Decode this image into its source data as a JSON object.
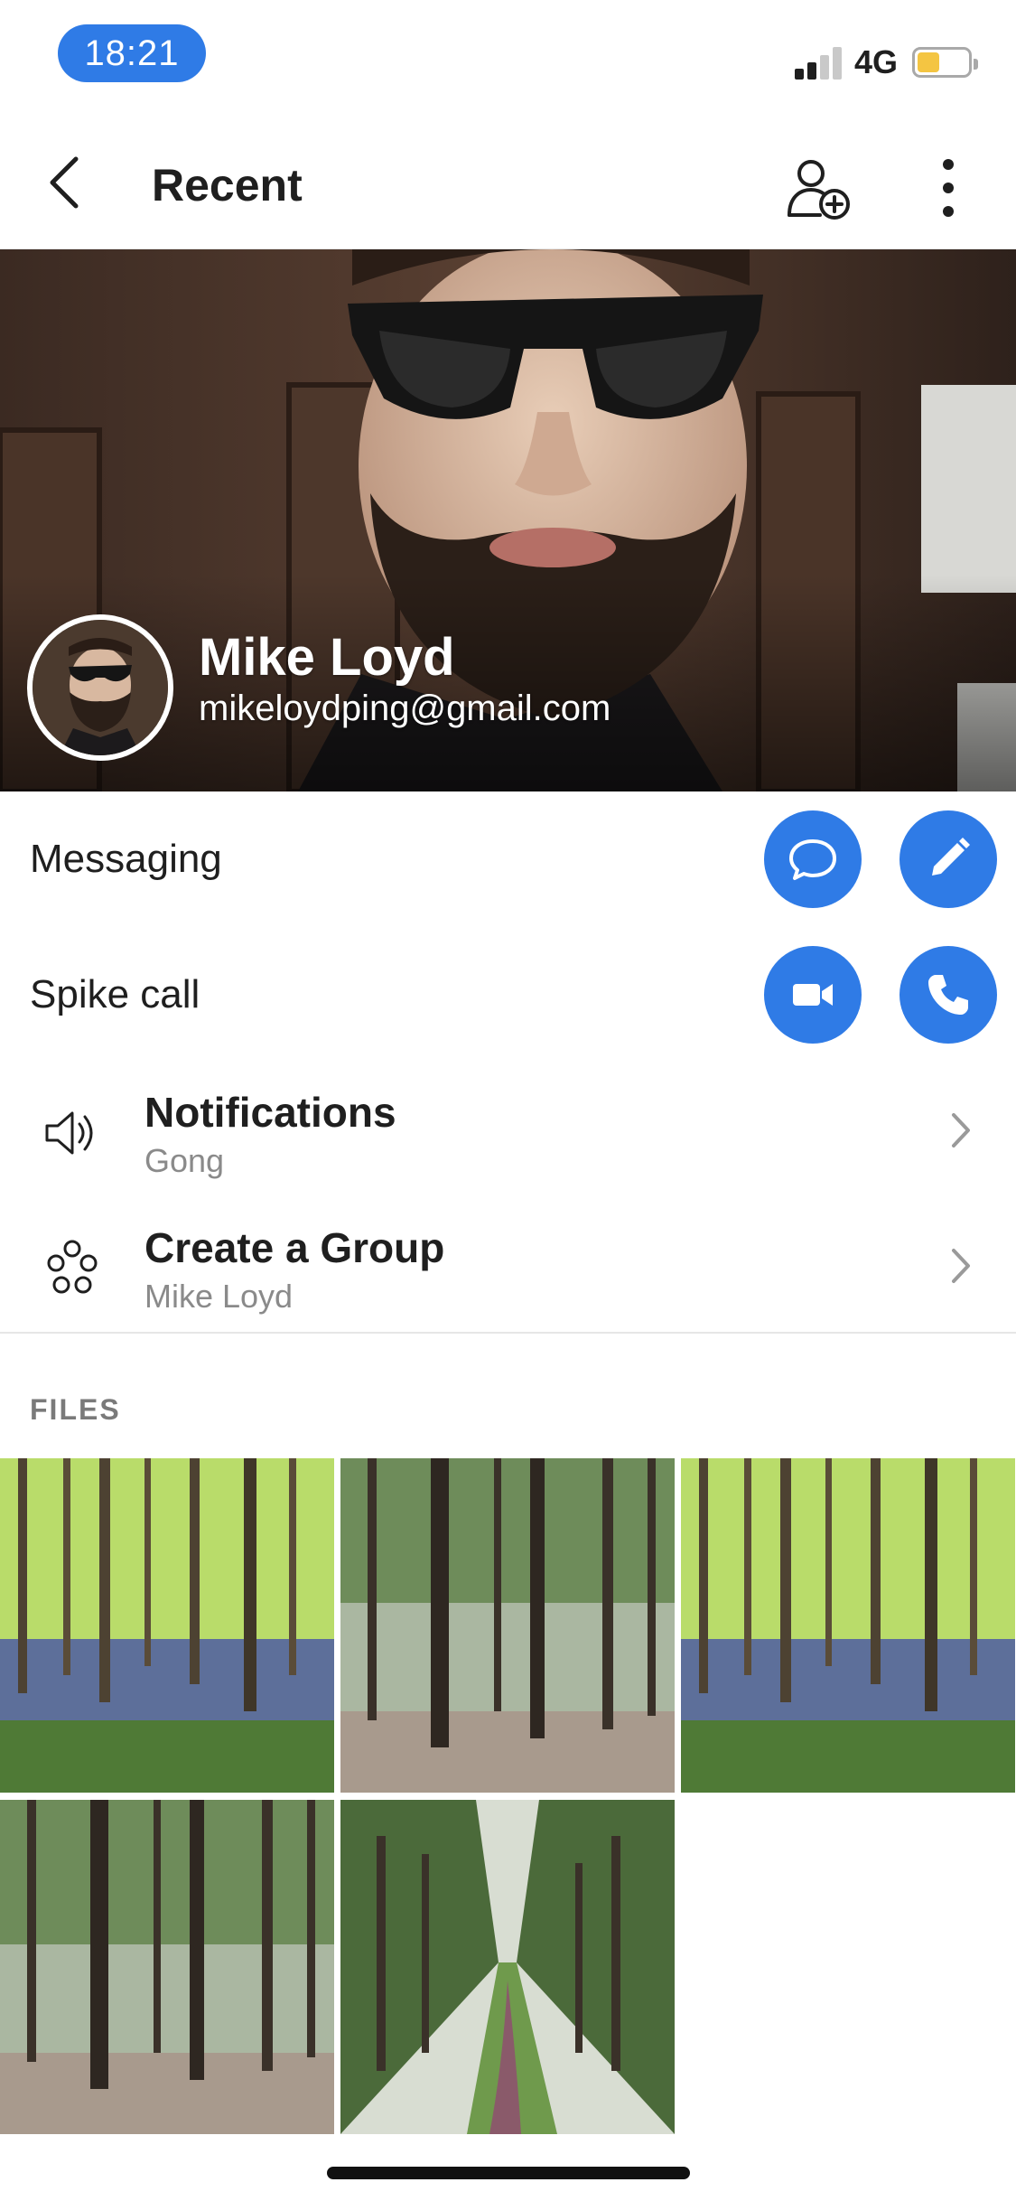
{
  "status_bar": {
    "time": "18:21",
    "network": "4G",
    "signal_bars": 2,
    "battery_level": 0.45,
    "colors": {
      "time_pill": "#2f7be6",
      "battery_fill": "#f4c542"
    }
  },
  "nav": {
    "title": "Recent",
    "back_icon": "chevron-left-icon",
    "add_contact_icon": "add-user-icon",
    "more_icon": "more-vertical-icon"
  },
  "profile": {
    "name": "Mike Loyd",
    "email": "mikeloydping@gmail.com"
  },
  "actions": [
    {
      "label": "Messaging",
      "buttons": [
        "chat-bubble-icon",
        "pencil-icon"
      ]
    },
    {
      "label": "Spike call",
      "buttons": [
        "video-camera-icon",
        "phone-icon"
      ]
    }
  ],
  "settings": [
    {
      "title": "Notifications",
      "subtitle": "Gong",
      "icon": "speaker-icon"
    },
    {
      "title": "Create a Group",
      "subtitle": "Mike Loyd",
      "icon": "group-icon"
    }
  ],
  "files": {
    "section_label": "FILES",
    "items": [
      "forest-bluebells",
      "forest-pines",
      "forest-bluebells",
      "forest-pines",
      "forest-path"
    ]
  },
  "accent_color": "#2f7be6"
}
